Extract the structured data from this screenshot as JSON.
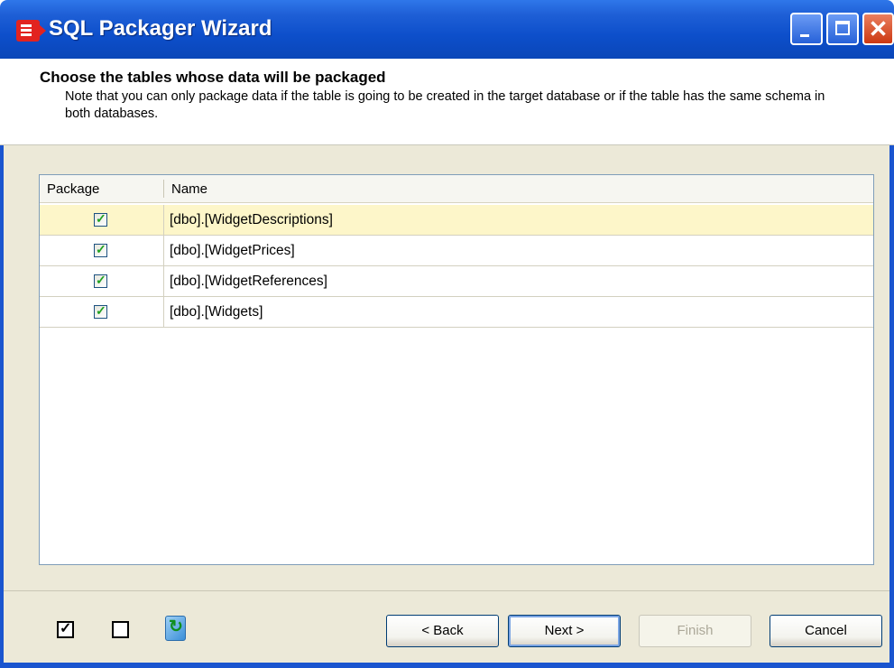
{
  "window": {
    "title": "SQL Packager Wizard",
    "buttons": [
      "minimize",
      "maximize",
      "close"
    ]
  },
  "header": {
    "heading": "Choose the tables whose data will be packaged",
    "note": "Note that you can only package data if the table is going to be created in the target database or if the table has the same schema in both databases."
  },
  "grid": {
    "columns": [
      "Package",
      "Name"
    ],
    "rows": [
      {
        "checked": true,
        "name": "[dbo].[WidgetDescriptions]",
        "selected": true
      },
      {
        "checked": true,
        "name": "[dbo].[WidgetPrices]",
        "selected": false
      },
      {
        "checked": true,
        "name": "[dbo].[WidgetReferences]",
        "selected": false
      },
      {
        "checked": true,
        "name": "[dbo].[Widgets]",
        "selected": false
      }
    ]
  },
  "footer": {
    "icons": [
      "select-all-checkbox-icon",
      "select-none-checkbox-icon",
      "refresh-icon"
    ],
    "buttons": {
      "back": "< Back",
      "next": "Next >",
      "finish": "Finish",
      "cancel": "Cancel"
    }
  },
  "colors": {
    "titlebar": "#0d4fcb",
    "body": "#ece9d8",
    "selected_row": "#fdf6c9",
    "check": "#21a121"
  }
}
